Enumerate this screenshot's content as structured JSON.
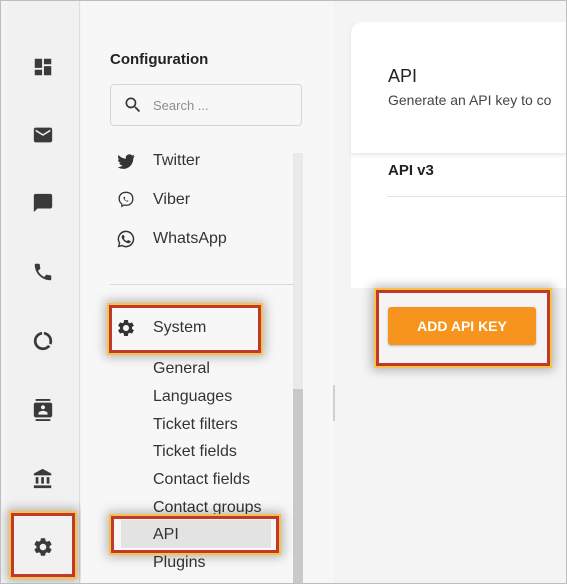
{
  "rail": {
    "items": [
      {
        "icon": "dashboard-icon"
      },
      {
        "icon": "mail-icon"
      },
      {
        "icon": "chat-icon"
      },
      {
        "icon": "phone-icon"
      },
      {
        "icon": "reports-icon"
      },
      {
        "icon": "contacts-icon"
      },
      {
        "icon": "bank-icon"
      },
      {
        "icon": "settings-icon",
        "selected": true
      }
    ]
  },
  "config": {
    "title": "Configuration",
    "search_placeholder": "Search ...",
    "channels": [
      {
        "label": "Twitter",
        "icon": "twitter-icon"
      },
      {
        "label": "Viber",
        "icon": "viber-icon"
      },
      {
        "label": "WhatsApp",
        "icon": "whatsapp-icon"
      }
    ],
    "system": {
      "label": "System",
      "icon": "gear-icon",
      "children": [
        "General",
        "Languages",
        "Ticket filters",
        "Ticket fields",
        "Contact fields",
        "Contact groups",
        "API",
        "Plugins"
      ],
      "selected": "API"
    }
  },
  "main": {
    "title": "API",
    "description": "Generate an API key to co",
    "version_label": "API v3",
    "add_button": "ADD API KEY",
    "accent_color": "#f7941d",
    "highlight_color": "#c0392b"
  }
}
